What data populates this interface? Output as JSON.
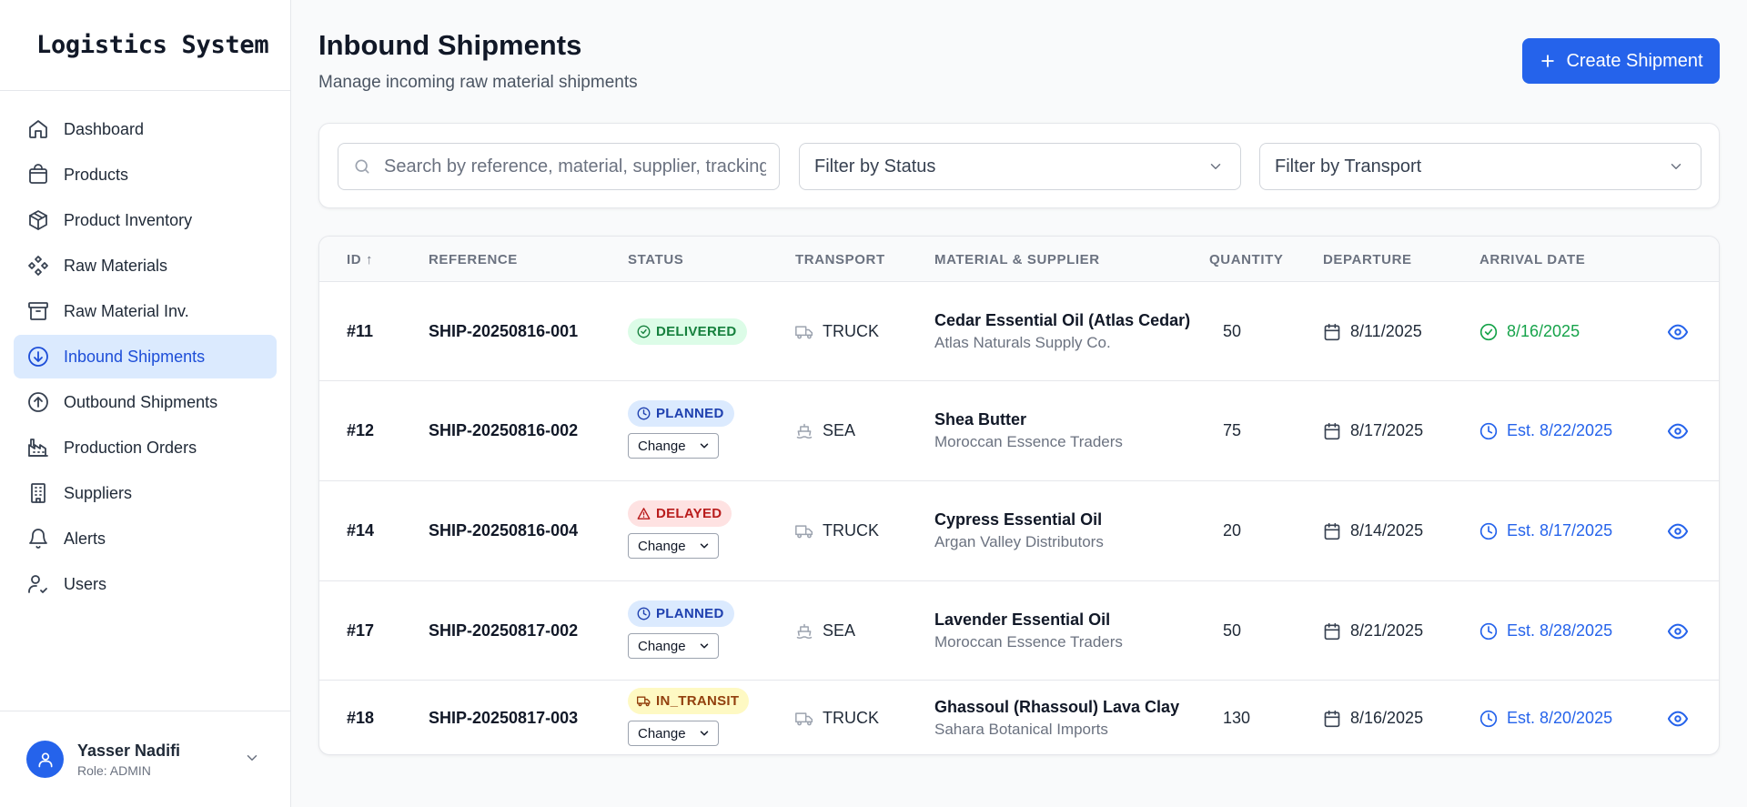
{
  "app": {
    "title": "Logistics System"
  },
  "sidebar": {
    "items": [
      {
        "label": "Dashboard",
        "icon": "home-icon",
        "active": false
      },
      {
        "label": "Products",
        "icon": "shopping-bag-icon",
        "active": false
      },
      {
        "label": "Product Inventory",
        "icon": "package-icon",
        "active": false
      },
      {
        "label": "Raw Materials",
        "icon": "component-icon",
        "active": false
      },
      {
        "label": "Raw Material Inv.",
        "icon": "archive-icon",
        "active": false
      },
      {
        "label": "Inbound Shipments",
        "icon": "arrow-down-circle-icon",
        "active": true
      },
      {
        "label": "Outbound Shipments",
        "icon": "arrow-up-circle-icon",
        "active": false
      },
      {
        "label": "Production Orders",
        "icon": "factory-icon",
        "active": false
      },
      {
        "label": "Suppliers",
        "icon": "building-icon",
        "active": false
      },
      {
        "label": "Alerts",
        "icon": "bell-icon",
        "active": false
      },
      {
        "label": "Users",
        "icon": "user-check-icon",
        "active": false
      }
    ]
  },
  "user": {
    "name": "Yasser Nadifi",
    "role": "Role: ADMIN"
  },
  "header": {
    "title": "Inbound Shipments",
    "subtitle": "Manage incoming raw material shipments",
    "create_label": "Create Shipment"
  },
  "filters": {
    "search_placeholder": "Search by reference, material, supplier, tracking...",
    "status_placeholder": "Filter by Status",
    "transport_placeholder": "Filter by Transport"
  },
  "table": {
    "headers": {
      "id": "ID ↑",
      "reference": "REFERENCE",
      "status": "STATUS",
      "transport": "TRANSPORT",
      "material": "MATERIAL & SUPPLIER",
      "quantity": "QUANTITY",
      "departure": "DEPARTURE",
      "arrival": "ARRIVAL DATE"
    },
    "change_label": "Change",
    "rows": [
      {
        "id": "#11",
        "reference": "SHIP-20250816-001",
        "status": "DELIVERED",
        "transport": "TRUCK",
        "material": "Cedar Essential Oil (Atlas Cedar)",
        "supplier": "Atlas Naturals Supply Co.",
        "quantity": "50",
        "departure": "8/11/2025",
        "arrival": "8/16/2025",
        "arrival_state": "done"
      },
      {
        "id": "#12",
        "reference": "SHIP-20250816-002",
        "status": "PLANNED",
        "transport": "SEA",
        "material": "Shea Butter",
        "supplier": "Moroccan Essence Traders",
        "quantity": "75",
        "departure": "8/17/2025",
        "arrival": "Est. 8/22/2025",
        "arrival_state": "est"
      },
      {
        "id": "#14",
        "reference": "SHIP-20250816-004",
        "status": "DELAYED",
        "transport": "TRUCK",
        "material": "Cypress Essential Oil",
        "supplier": "Argan Valley Distributors",
        "quantity": "20",
        "departure": "8/14/2025",
        "arrival": "Est. 8/17/2025",
        "arrival_state": "est"
      },
      {
        "id": "#17",
        "reference": "SHIP-20250817-002",
        "status": "PLANNED",
        "transport": "SEA",
        "material": "Lavender Essential Oil",
        "supplier": "Moroccan Essence Traders",
        "quantity": "50",
        "departure": "8/21/2025",
        "arrival": "Est. 8/28/2025",
        "arrival_state": "est"
      },
      {
        "id": "#18",
        "reference": "SHIP-20250817-003",
        "status": "IN_TRANSIT",
        "transport": "TRUCK",
        "material": "Ghassoul (Rhassoul) Lava Clay",
        "supplier": "Sahara Botanical Imports",
        "quantity": "130",
        "departure": "8/16/2025",
        "arrival": "Est. 8/20/2025",
        "arrival_state": "est"
      }
    ]
  },
  "colors": {
    "accent": "#2563eb",
    "active_bg": "#dbeafe",
    "delivered": "#16a34a"
  }
}
